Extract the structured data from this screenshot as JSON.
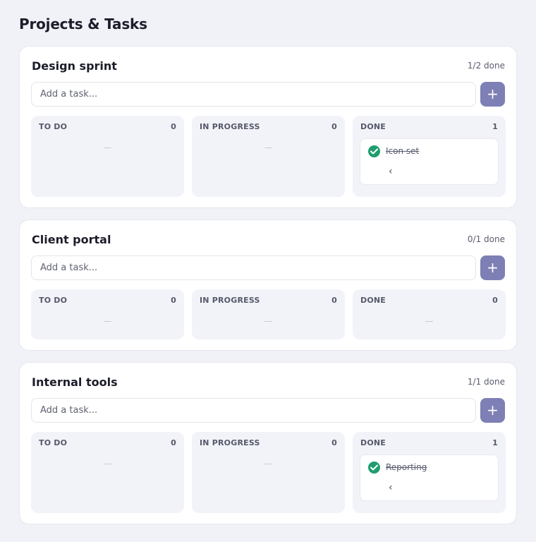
{
  "page": {
    "title": "Projects & Tasks"
  },
  "projects": [
    {
      "name": "Design sprint",
      "progress": "1/2 done",
      "input_placeholder": "Add a task...",
      "add_label": "+",
      "columns": [
        {
          "label": "TO DO",
          "count": "0",
          "empty": "—"
        },
        {
          "label": "IN PROGRESS",
          "count": "0",
          "empty": "—"
        },
        {
          "label": "DONE",
          "count": "1",
          "task": {
            "title": "Icon set",
            "back": "‹"
          }
        }
      ]
    },
    {
      "name": "Client portal",
      "progress": "0/1 done",
      "input_placeholder": "Add a task...",
      "add_label": "+",
      "columns": [
        {
          "label": "TO DO",
          "count": "0",
          "empty": "—"
        },
        {
          "label": "IN PROGRESS",
          "count": "0",
          "empty": "—"
        },
        {
          "label": "DONE",
          "count": "0",
          "empty": "—"
        }
      ]
    },
    {
      "name": "Internal tools",
      "progress": "1/1 done",
      "input_placeholder": "Add a task...",
      "add_label": "+",
      "columns": [
        {
          "label": "TO DO",
          "count": "0",
          "empty": "—"
        },
        {
          "label": "IN PROGRESS",
          "count": "0",
          "empty": "—"
        },
        {
          "label": "DONE",
          "count": "1",
          "task": {
            "title": "Reporting",
            "back": "‹"
          }
        }
      ]
    }
  ],
  "colors": {
    "background": "#f1f2f8",
    "accent": "#7e7fb4",
    "done_check": "#1f9d6e",
    "column_bg": "#f2f3f9"
  },
  "icons": {
    "add": "plus-icon",
    "done": "check-circle-icon",
    "back": "chevron-left-icon"
  }
}
